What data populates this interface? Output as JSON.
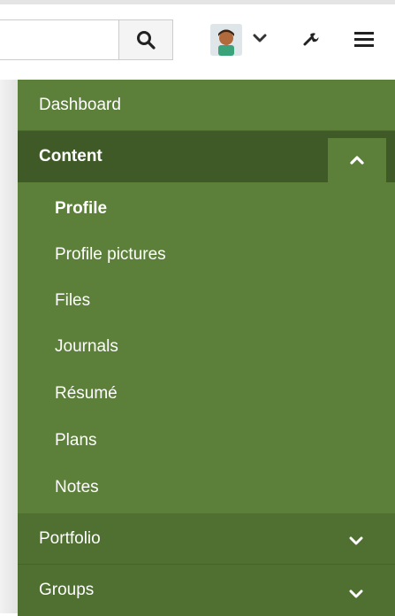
{
  "search": {
    "value": "",
    "placeholder": ""
  },
  "icons": {
    "search": "search-icon",
    "avatar": "user-avatar",
    "avatar_dropdown": "chevron-down-icon",
    "admin": "wrench-icon",
    "menu": "hamburger-menu-icon"
  },
  "colors": {
    "sidebar_bg": "#5c7f3a",
    "section_active_bg": "#3f5a27",
    "collapsed_section_bg": "#4f7030",
    "text": "#ffffff"
  },
  "nav": {
    "dashboard": "Dashboard",
    "content": {
      "label": "Content",
      "expanded": true,
      "items": [
        {
          "label": "Profile",
          "active": true
        },
        {
          "label": "Profile pictures"
        },
        {
          "label": "Files"
        },
        {
          "label": "Journals"
        },
        {
          "label": "Résumé"
        },
        {
          "label": "Plans"
        },
        {
          "label": "Notes"
        }
      ]
    },
    "portfolio": "Portfolio",
    "groups": "Groups"
  }
}
